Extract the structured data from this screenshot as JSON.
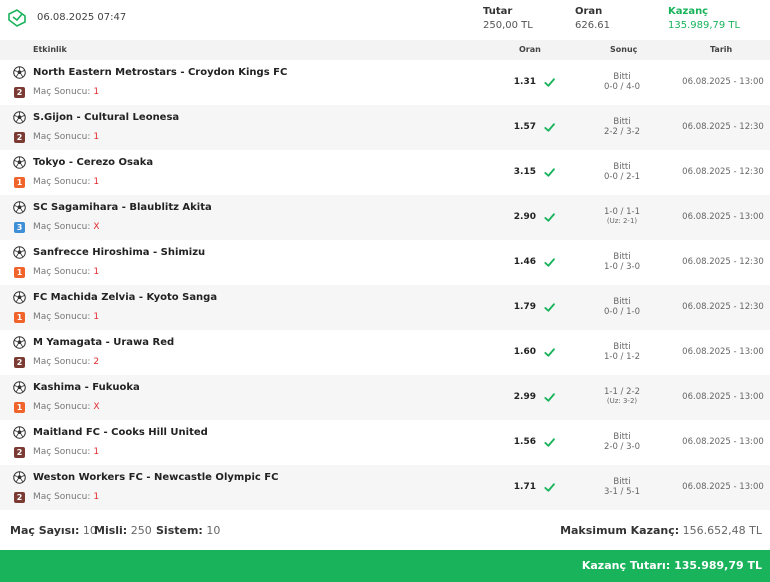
{
  "header": {
    "datetime": "06.08.2025 07:47",
    "tutar_label": "Tutar",
    "tutar_value": "250,00 TL",
    "oran_label": "Oran",
    "oran_value": "626.61",
    "kazanc_label": "Kazanç",
    "kazanc_value": "135.989,79 TL"
  },
  "columns": {
    "event": "Etkinlik",
    "odd": "Oran",
    "result": "Sonuç",
    "date": "Tarih"
  },
  "market_label": "Maç Sonucu:",
  "colors": {
    "accent_green": "#19b35b",
    "badge_1": "#f0632a",
    "badge_2": "#7b3b32",
    "badge_3": "#3e8fd6",
    "pick_red": "#e0292f"
  },
  "bets": [
    {
      "match": "North Eastern Metrostars - Croydon Kings FC",
      "badge": "2",
      "pick": "1",
      "odd": "1.31",
      "status": "Bitti",
      "score": "0-0 / 4-0",
      "extra": "",
      "date": "06.08.2025 - 13:00",
      "icon": "soccer-ball-icon"
    },
    {
      "match": "S.Gijon - Cultural Leonesa",
      "badge": "2",
      "pick": "1",
      "odd": "1.57",
      "status": "Bitti",
      "score": "2-2 / 3-2",
      "extra": "",
      "date": "06.08.2025 - 12:30",
      "icon": "soccer-ball-icon"
    },
    {
      "match": "Tokyo - Cerezo Osaka",
      "badge": "1",
      "pick": "1",
      "odd": "3.15",
      "status": "Bitti",
      "score": "0-0 / 2-1",
      "extra": "",
      "date": "06.08.2025 - 12:30",
      "icon": "soccer-ball-icon"
    },
    {
      "match": "SC Sagamihara - Blaublitz Akita",
      "badge": "3",
      "pick": "X",
      "odd": "2.90",
      "status": "",
      "score": "1-0 / 1-1",
      "extra": "(Uz: 2-1)",
      "date": "06.08.2025 - 13:00",
      "icon": "soccer-ball-icon"
    },
    {
      "match": "Sanfrecce Hiroshima - Shimizu",
      "badge": "1",
      "pick": "1",
      "odd": "1.46",
      "status": "Bitti",
      "score": "1-0 / 3-0",
      "extra": "",
      "date": "06.08.2025 - 12:30",
      "icon": "soccer-ball-icon"
    },
    {
      "match": "FC Machida Zelvia - Kyoto Sanga",
      "badge": "1",
      "pick": "1",
      "odd": "1.79",
      "status": "Bitti",
      "score": "0-0 / 1-0",
      "extra": "",
      "date": "06.08.2025 - 12:30",
      "icon": "soccer-ball-icon"
    },
    {
      "match": "M Yamagata - Urawa Red",
      "badge": "2",
      "pick": "2",
      "odd": "1.60",
      "status": "Bitti",
      "score": "1-0 / 1-2",
      "extra": "",
      "date": "06.08.2025 - 13:00",
      "icon": "soccer-ball-icon"
    },
    {
      "match": "Kashima - Fukuoka",
      "badge": "1",
      "pick": "X",
      "odd": "2.99",
      "status": "",
      "score": "1-1 / 2-2",
      "extra": "(Uz: 3-2)",
      "date": "06.08.2025 - 13:00",
      "icon": "soccer-ball-icon"
    },
    {
      "match": "Maitland FC - Cooks Hill United",
      "badge": "2",
      "pick": "1",
      "odd": "1.56",
      "status": "Bitti",
      "score": "2-0 / 3-0",
      "extra": "",
      "date": "06.08.2025 - 13:00",
      "icon": "soccer-ball-icon"
    },
    {
      "match": "Weston Workers FC - Newcastle Olympic FC",
      "badge": "2",
      "pick": "1",
      "odd": "1.71",
      "status": "Bitti",
      "score": "3-1 / 5-1",
      "extra": "",
      "date": "06.08.2025 - 13:00",
      "icon": "soccer-ball-icon"
    }
  ],
  "summary": {
    "mac_label": "Maç Sayısı:",
    "mac_value": "10",
    "misli_label": "Misli:",
    "misli_value": "250",
    "sistem_label": "Sistem:",
    "sistem_value": "10",
    "max_label": "Maksimum Kazanç:",
    "max_value": "156.652,48 TL"
  },
  "footer": {
    "label": "Kazanç Tutarı:",
    "value": "135.989,79 TL"
  }
}
